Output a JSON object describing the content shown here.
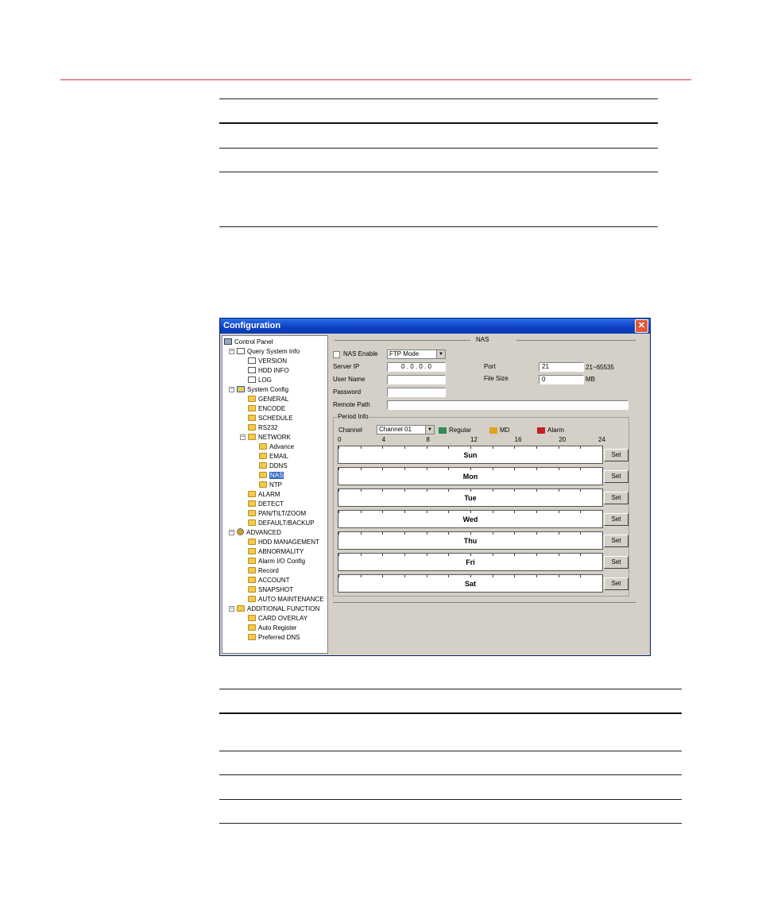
{
  "window": {
    "title": "Configuration",
    "close_symbol": "✕"
  },
  "tree": [
    {
      "label": "Control Panel",
      "icon": "computer-icon",
      "indent": 0
    },
    {
      "label": "Query System Info",
      "icon": "info-doc-icon",
      "indent": 1,
      "expander": "−"
    },
    {
      "label": "VERSION",
      "icon": "document-icon",
      "indent": 2
    },
    {
      "label": "HDD INFO",
      "icon": "document-icon",
      "indent": 2
    },
    {
      "label": "LOG",
      "icon": "document-icon",
      "indent": 2
    },
    {
      "label": "System Config",
      "icon": "system-config-icon",
      "indent": 1,
      "expander": "−"
    },
    {
      "label": "GENERAL",
      "icon": "folder-icon",
      "indent": 2
    },
    {
      "label": "ENCODE",
      "icon": "folder-icon",
      "indent": 2
    },
    {
      "label": "SCHEDULE",
      "icon": "folder-icon",
      "indent": 2
    },
    {
      "label": "RS232",
      "icon": "folder-icon",
      "indent": 2
    },
    {
      "label": "NETWORK",
      "icon": "folder-icon",
      "indent": 2,
      "expander": "−"
    },
    {
      "label": "Advance",
      "icon": "folder-icon",
      "indent": 3
    },
    {
      "label": "EMAIL",
      "icon": "folder-icon",
      "indent": 3
    },
    {
      "label": "DDNS",
      "icon": "folder-icon",
      "indent": 3
    },
    {
      "label": "NAS",
      "icon": "folder-open-icon",
      "indent": 3,
      "selected": true
    },
    {
      "label": "NTP",
      "icon": "folder-icon",
      "indent": 3
    },
    {
      "label": "ALARM",
      "icon": "folder-icon",
      "indent": 2
    },
    {
      "label": "DETECT",
      "icon": "folder-icon",
      "indent": 2
    },
    {
      "label": "PAN/TILT/ZOOM",
      "icon": "folder-icon",
      "indent": 2
    },
    {
      "label": "DEFAULT/BACKUP",
      "icon": "folder-icon",
      "indent": 2
    },
    {
      "label": "ADVANCED",
      "icon": "gear-icon",
      "indent": 1,
      "expander": "−"
    },
    {
      "label": "HDD MANAGEMENT",
      "icon": "folder-icon",
      "indent": 2
    },
    {
      "label": "ABNORMALITY",
      "icon": "folder-icon",
      "indent": 2
    },
    {
      "label": "Alarm I/O Config",
      "icon": "folder-icon",
      "indent": 2
    },
    {
      "label": "Record",
      "icon": "folder-icon",
      "indent": 2
    },
    {
      "label": "ACCOUNT",
      "icon": "folder-icon",
      "indent": 2
    },
    {
      "label": "SNAPSHOT",
      "icon": "folder-icon",
      "indent": 2
    },
    {
      "label": "AUTO MAINTENANCE",
      "icon": "folder-icon",
      "indent": 2
    },
    {
      "label": "ADDITIONAL FUNCTION",
      "icon": "folder-icon",
      "indent": 1,
      "expander": "−"
    },
    {
      "label": "CARD OVERLAY",
      "icon": "folder-icon",
      "indent": 2
    },
    {
      "label": "Auto Register",
      "icon": "folder-icon",
      "indent": 2
    },
    {
      "label": "Preferred DNS",
      "icon": "folder-icon",
      "indent": 2
    }
  ],
  "nas": {
    "section_title": "NAS",
    "enable_label": "NAS Enable",
    "mode_value": "FTP Mode",
    "server_ip_label": "Server IP",
    "server_ip_value": "0 . 0 . 0 . 0",
    "port_label": "Port",
    "port_value": "21",
    "port_range": "21~65535",
    "user_name_label": "User Name",
    "user_name_value": "",
    "file_size_label": "File Size",
    "file_size_value": "0",
    "file_size_unit": "MB",
    "password_label": "Password",
    "password_value": "",
    "remote_path_label": "Remote Path",
    "remote_path_value": ""
  },
  "period": {
    "group_title": "Period Info",
    "channel_label": "Channel",
    "channel_value": "Channel 01",
    "legend": [
      {
        "label": "Regular",
        "color": "#2e8b57"
      },
      {
        "label": "MD",
        "color": "#e0a020"
      },
      {
        "label": "Alarm",
        "color": "#c02020"
      }
    ],
    "hours": [
      "0",
      "4",
      "8",
      "12",
      "16",
      "20",
      "24"
    ],
    "days": [
      "Sun",
      "Mon",
      "Tue",
      "Wed",
      "Thu",
      "Fri",
      "Sat"
    ],
    "set_label": "Set"
  },
  "colors": {
    "title_bar": "#0a3fc4",
    "selection": "#316ac5",
    "header_rule": "#d63b3b"
  }
}
